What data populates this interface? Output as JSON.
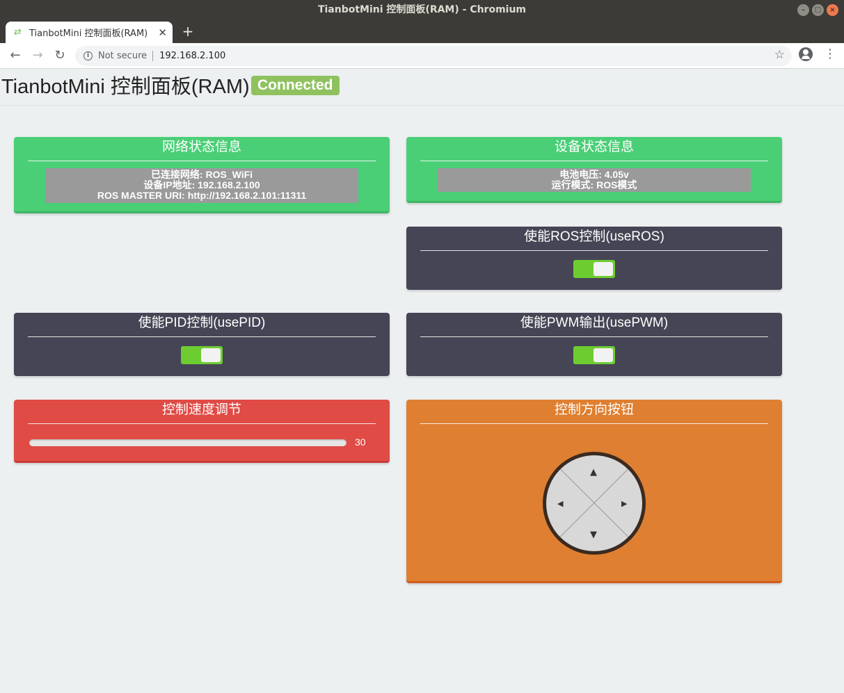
{
  "window": {
    "title": "TianbotMini 控制面板(RAM) - Chromium"
  },
  "browser": {
    "tab_title": "TianbotMini 控制面板(RAM)",
    "new_tab_label": "+",
    "security_label": "Not secure",
    "url": "192.168.2.100"
  },
  "page": {
    "title": "TianbotMini 控制面板(RAM)",
    "status_badge": "Connected"
  },
  "network_panel": {
    "title": "网络状态信息",
    "lines": [
      "已连接网络: ROS_WiFi",
      "设备IP地址: 192.168.2.100",
      "ROS MASTER URI: http://192.168.2.101:11311"
    ]
  },
  "device_panel": {
    "title": "设备状态信息",
    "lines": [
      "电池电压: 4.05v",
      "运行模式: ROS模式"
    ]
  },
  "ros_panel": {
    "title": "使能ROS控制(useROS)",
    "enabled": true
  },
  "pid_panel": {
    "title": "使能PID控制(usePID)",
    "enabled": true
  },
  "pwm_panel": {
    "title": "使能PWM输出(usePWM)",
    "enabled": true
  },
  "speed_panel": {
    "title": "控制速度调节",
    "value": "30"
  },
  "direction_panel": {
    "title": "控制方向按钮",
    "arrows": {
      "up": "▲",
      "down": "▼",
      "left": "◀",
      "right": "▶"
    }
  },
  "colors": {
    "green_panel": "#4acf76",
    "dark_panel": "#454555",
    "red_panel": "#e04b45",
    "orange_panel": "#df7f31",
    "toggle_on": "#6dcd30",
    "badge": "#8fc25f"
  }
}
